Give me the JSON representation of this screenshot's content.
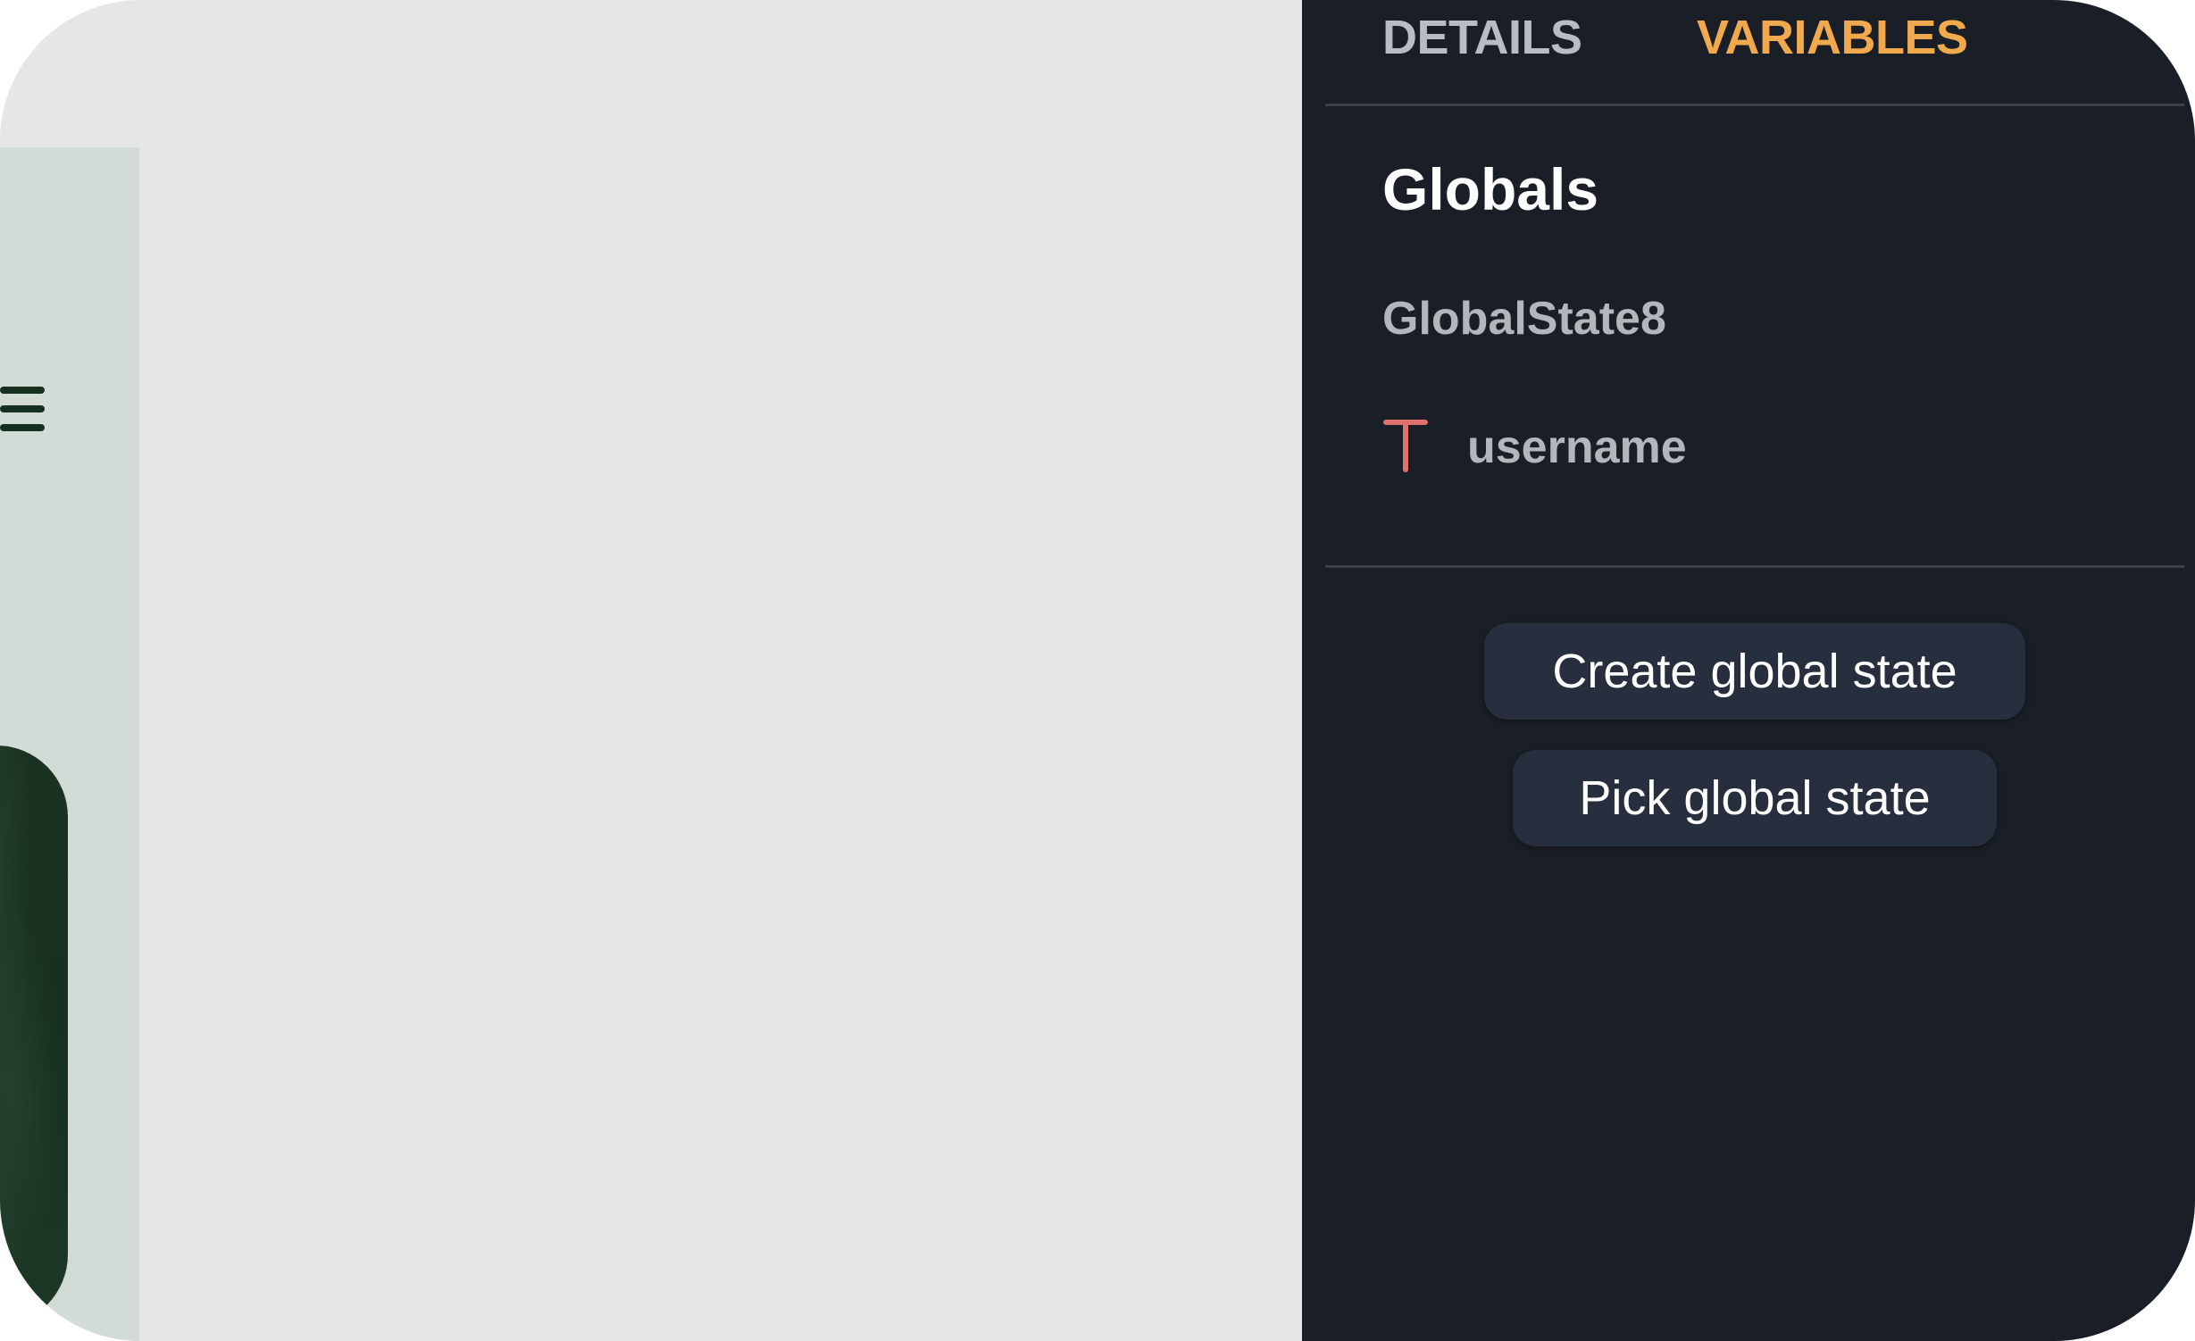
{
  "panel": {
    "tabs": [
      {
        "label": "DETAILS",
        "active": false
      },
      {
        "label": "VARIABLES",
        "active": true
      }
    ],
    "section_title": "Globals",
    "group": {
      "name": "GlobalState8",
      "variables": [
        {
          "type_icon": "text-type-icon",
          "name": "username"
        }
      ]
    },
    "buttons": {
      "create_label": "Create global state",
      "pick_label": "Pick global state"
    }
  },
  "colors": {
    "panel_bg": "#1a1e26",
    "active_tab": "#f1a94e",
    "inactive_tab": "#b9bcc2",
    "button_bg": "#272e3d",
    "text_type_icon": "#e0706d",
    "canvas_bg": "#e6e6e6",
    "phone_strip_bg": "#d3dbd6"
  }
}
